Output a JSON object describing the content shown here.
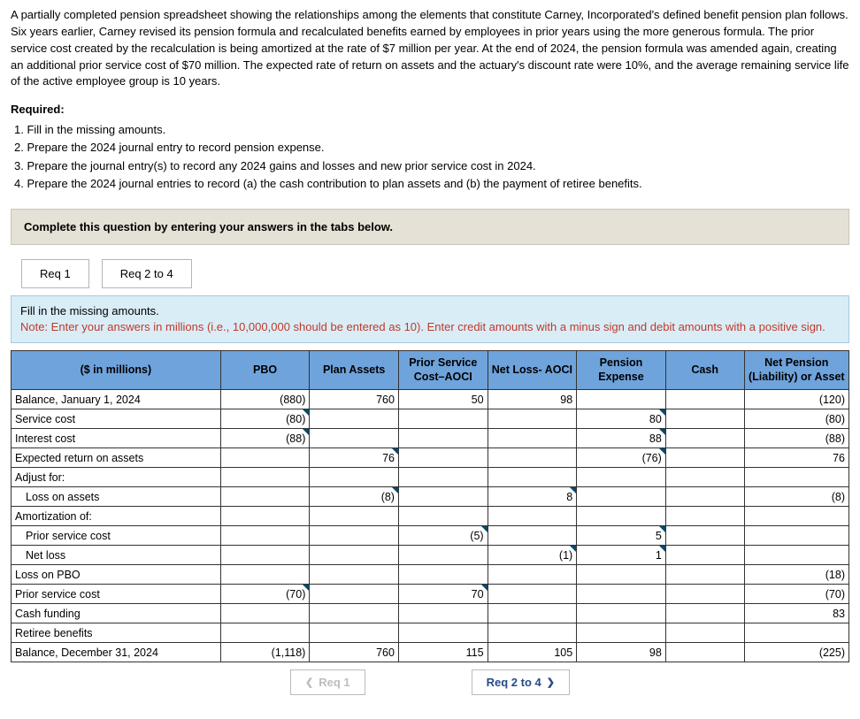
{
  "intro": "A partially completed pension spreadsheet showing the relationships among the elements that constitute Carney, Incorporated's defined benefit pension plan follows. Six years earlier, Carney revised its pension formula and recalculated benefits earned by employees in prior years using the more generous formula. The prior service cost created by the recalculation is being amortized at the rate of $7 million per year. At the end of 2024, the pension formula was amended again, creating an additional prior service cost of $70 million. The expected rate of return on assets and the actuary's discount rate were 10%, and the average remaining service life of the active employee group is 10 years.",
  "required_label": "Required:",
  "requirements": [
    "1. Fill in the missing amounts.",
    "2. Prepare the 2024 journal entry to record pension expense.",
    "3. Prepare the journal entry(s) to record any 2024 gains and losses and new prior service cost in 2024.",
    "4. Prepare the 2024 journal entries to record (a) the cash contribution to plan assets and (b) the payment of retiree benefits."
  ],
  "instruction_bar": "Complete this question by entering your answers in the tabs below.",
  "tabs": {
    "t1": "Req 1",
    "t2": "Req 2 to 4"
  },
  "note": {
    "line1": "Fill in the missing amounts.",
    "line2": "Note: Enter your answers in millions (i.e., 10,000,000 should be entered as 10). Enter credit amounts with a minus sign and debit amounts with a positive sign."
  },
  "headers": {
    "c0": "($ in millions)",
    "c1": "PBO",
    "c2": "Plan Assets",
    "c3": "Prior Service Cost–AOCI",
    "c4": "Net Loss- AOCI",
    "c5": "Pension Expense",
    "c6": "Cash",
    "c7": "Net Pension (Liability) or Asset"
  },
  "rows": [
    {
      "label": "Balance, January 1, 2024",
      "indent": 0,
      "cells": {
        "c1": {
          "v": "(880)",
          "corner": false
        },
        "c2": {
          "v": "760",
          "corner": false
        },
        "c3": {
          "v": "50",
          "corner": false
        },
        "c4": {
          "v": "98",
          "corner": false
        },
        "c7": {
          "v": "(120)",
          "corner": false
        }
      }
    },
    {
      "label": "Service cost",
      "indent": 0,
      "cells": {
        "c1": {
          "v": "(80)",
          "corner": true
        },
        "c5": {
          "v": "80",
          "corner": true
        },
        "c7": {
          "v": "(80)",
          "corner": false
        }
      }
    },
    {
      "label": "Interest cost",
      "indent": 0,
      "cells": {
        "c1": {
          "v": "(88)",
          "corner": true
        },
        "c5": {
          "v": "88",
          "corner": true
        },
        "c7": {
          "v": "(88)",
          "corner": false
        }
      }
    },
    {
      "label": "Expected return on assets",
      "indent": 0,
      "cells": {
        "c2": {
          "v": "76",
          "corner": true
        },
        "c5": {
          "v": "(76)",
          "corner": true
        },
        "c7": {
          "v": "76",
          "corner": false
        }
      }
    },
    {
      "label": "Adjust for:",
      "indent": 0,
      "cells": {}
    },
    {
      "label": "Loss on assets",
      "indent": 1,
      "cells": {
        "c2": {
          "v": "(8)",
          "corner": true
        },
        "c4": {
          "v": "8",
          "corner": true
        },
        "c7": {
          "v": "(8)",
          "corner": false
        }
      }
    },
    {
      "label": "Amortization of:",
      "indent": 0,
      "cells": {}
    },
    {
      "label": "Prior service cost",
      "indent": 1,
      "cells": {
        "c3": {
          "v": "(5)",
          "corner": true
        },
        "c5": {
          "v": "5",
          "corner": true
        }
      }
    },
    {
      "label": "Net loss",
      "indent": 1,
      "cells": {
        "c4": {
          "v": "(1)",
          "corner": true
        },
        "c5": {
          "v": "1",
          "corner": true
        }
      }
    },
    {
      "label": "Loss on PBO",
      "indent": 0,
      "cells": {
        "c7": {
          "v": "(18)",
          "corner": false
        }
      }
    },
    {
      "label": "Prior service cost",
      "indent": 0,
      "cells": {
        "c1": {
          "v": "(70)",
          "corner": true
        },
        "c3": {
          "v": "70",
          "corner": true
        },
        "c7": {
          "v": "(70)",
          "corner": false
        }
      }
    },
    {
      "label": "Cash funding",
      "indent": 0,
      "cells": {
        "c7": {
          "v": "83",
          "corner": false
        }
      }
    },
    {
      "label": "Retiree benefits",
      "indent": 0,
      "cells": {}
    },
    {
      "label": "Balance, December 31, 2024",
      "indent": 0,
      "cells": {
        "c1": {
          "v": "(1,118)",
          "corner": false
        },
        "c2": {
          "v": "760",
          "corner": false
        },
        "c3": {
          "v": "115",
          "corner": false
        },
        "c4": {
          "v": "105",
          "corner": false
        },
        "c5": {
          "v": "98",
          "corner": false
        },
        "c7": {
          "v": "(225)",
          "corner": false
        }
      }
    }
  ],
  "nav": {
    "prev": "Req 1",
    "next": "Req 2 to 4"
  }
}
